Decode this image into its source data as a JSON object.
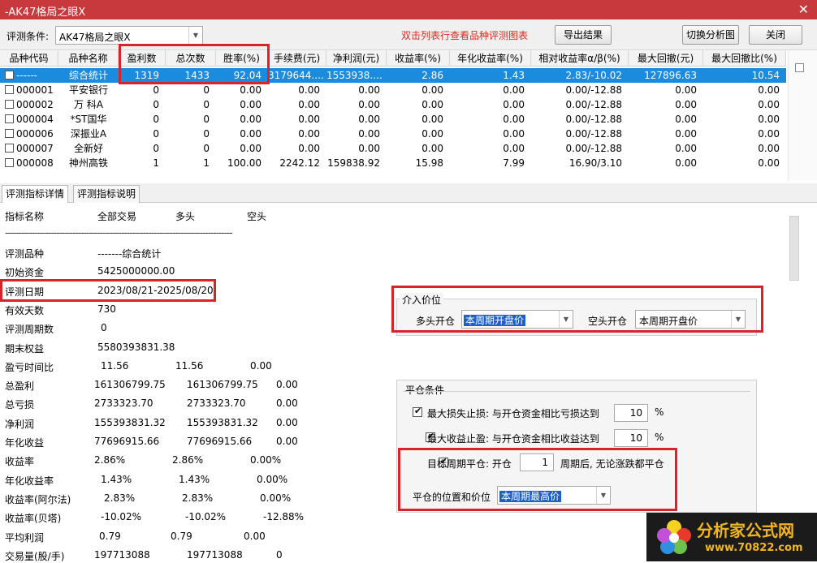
{
  "window": {
    "title": "-AK47格局之眼X",
    "close_glyph": "✕"
  },
  "toolbar": {
    "condition_label": "评测条件:",
    "condition_value": "AK47格局之眼X",
    "hint": "双击列表行查看品种评测图表",
    "export_label": "导出结果",
    "switch_label": "切换分析图",
    "close_label": "关闭"
  },
  "grid": {
    "columns": [
      "品种代码",
      "品种名称",
      "盈利数",
      "总次数",
      "胜率(%)",
      "手续费(元)",
      "净利润(元)",
      "收益率(%)",
      "年化收益率(%)",
      "相对收益率α/β(%)",
      "最大回撤(元)",
      "最大回撤比(%)"
    ],
    "rows": [
      [
        "------",
        "综合统计",
        "1319",
        "1433",
        "92.04",
        "3179644....",
        "1553938....",
        "2.86",
        "1.43",
        "2.83/-10.02",
        "127896.63",
        "10.54"
      ],
      [
        "000001",
        "平安银行",
        "0",
        "0",
        "0.00",
        "0.00",
        "0.00",
        "0.00",
        "0.00",
        "0.00/-12.88",
        "0.00",
        "0.00"
      ],
      [
        "000002",
        "万 科A",
        "0",
        "0",
        "0.00",
        "0.00",
        "0.00",
        "0.00",
        "0.00",
        "0.00/-12.88",
        "0.00",
        "0.00"
      ],
      [
        "000004",
        "*ST国华",
        "0",
        "0",
        "0.00",
        "0.00",
        "0.00",
        "0.00",
        "0.00",
        "0.00/-12.88",
        "0.00",
        "0.00"
      ],
      [
        "000006",
        "深振业A",
        "0",
        "0",
        "0.00",
        "0.00",
        "0.00",
        "0.00",
        "0.00",
        "0.00/-12.88",
        "0.00",
        "0.00"
      ],
      [
        "000007",
        "全新好",
        "0",
        "0",
        "0.00",
        "0.00",
        "0.00",
        "0.00",
        "0.00",
        "0.00/-12.88",
        "0.00",
        "0.00"
      ],
      [
        "000008",
        "神州高铁",
        "1",
        "1",
        "100.00",
        "2242.12",
        "159838.92",
        "15.98",
        "7.99",
        "16.90/3.10",
        "0.00",
        "0.00"
      ]
    ]
  },
  "tabs": [
    "评测指标详情",
    "评测指标说明"
  ],
  "detail": {
    "header": [
      "指标名称",
      "全部交易",
      "多头",
      "空头"
    ],
    "separator": "------------------------------------------------------------------------------------",
    "rows": [
      {
        "label": "评测品种",
        "v1": "-------综合统计",
        "v2": "",
        "v3": ""
      },
      {
        "label": "初始资金",
        "v1": "5425000000.00",
        "v2": "",
        "v3": ""
      },
      {
        "label": "评测日期",
        "v1": "2023/08/21-2025/08/20",
        "v2": "",
        "v3": ""
      },
      {
        "label": "有效天数",
        "v1": "730",
        "v2": "",
        "v3": ""
      },
      {
        "label": "评测周期数",
        "v1": "0",
        "v2": "",
        "v3": ""
      },
      {
        "label": "期末权益",
        "v1": "5580393831.38",
        "v2": "",
        "v3": ""
      },
      {
        "label": "盈亏时间比",
        "v1": "11.56",
        "v2": "11.56",
        "v3": "0.00"
      },
      {
        "label": "总盈利",
        "v1": "161306799.75",
        "v2": "161306799.75",
        "v3": "0.00"
      },
      {
        "label": "总亏损",
        "v1": "2733323.70",
        "v2": "2733323.70",
        "v3": "0.00"
      },
      {
        "label": "净利润",
        "v1": "155393831.32",
        "v2": "155393831.32",
        "v3": "0.00"
      },
      {
        "label": "年化收益",
        "v1": "77696915.66",
        "v2": "77696915.66",
        "v3": "0.00"
      },
      {
        "label": "收益率",
        "v1": "2.86%",
        "v2": "2.86%",
        "v3": "0.00%"
      },
      {
        "label": "年化收益率",
        "v1": "1.43%",
        "v2": "1.43%",
        "v3": "0.00%"
      },
      {
        "label": "收益率(阿尔法)",
        "v1": "2.83%",
        "v2": "2.83%",
        "v3": "0.00%"
      },
      {
        "label": "收益率(贝塔)",
        "v1": "-10.02%",
        "v2": "-10.02%",
        "v3": "-12.88%"
      },
      {
        "label": "平均利润",
        "v1": "0.79",
        "v2": "0.79",
        "v3": "0.00"
      },
      {
        "label": "交易量(股/手)",
        "v1": "197713088",
        "v2": "197713088",
        "v3": "0"
      }
    ]
  },
  "entry": {
    "group_label": "介入价位",
    "long_label": "多头开仓",
    "long_value": "本周期开盘价",
    "short_label": "空头开仓",
    "short_value": "本周期开盘价"
  },
  "exit": {
    "group_label": "平仓条件",
    "stop_loss_text": "最大损失止损: 与开仓资金相比亏损达到",
    "stop_loss_value": "10",
    "take_profit_text": "最大收益止盈: 与开仓资金相比收益达到",
    "take_profit_value": "10",
    "percent": "%",
    "target_text": "目标周期平仓: 开仓",
    "target_value": "1",
    "target_suffix": "周期后, 无论涨跌都平仓",
    "position_label": "平仓的位置和价位",
    "position_value": "本周期最高价"
  },
  "watermark": {
    "brand": "分析家公式网",
    "url": "www.70822.com"
  },
  "colors": {
    "title_bar": "#c8393c",
    "selection": "#1b8bde",
    "highlight_box": "#d8232a",
    "hint": "#e0281e"
  }
}
